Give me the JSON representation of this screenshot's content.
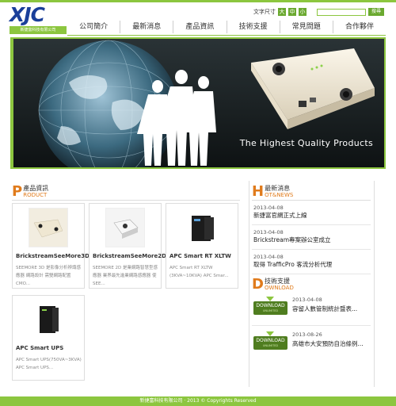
{
  "header": {
    "logo_text": "XJC",
    "logo_tagline": "新捷富科技有限公司",
    "font_size_label": "文字尺寸",
    "font_sizes": [
      "大",
      "中",
      "小"
    ],
    "search_placeholder": "",
    "search_button": "搜尋"
  },
  "nav": {
    "items": [
      "公司簡介",
      "最新消息",
      "產品資訊",
      "技術支援",
      "常見問題",
      "合作夥伴"
    ]
  },
  "banner": {
    "caption": "The Highest Quality Products"
  },
  "products": {
    "big": "P",
    "title_zh": "產品資訊",
    "title_en": "RODUCT",
    "items": [
      {
        "name": "BrickstreamSeeMore3D",
        "desc": "SEEMORE 3D 是影像分析辨識感應器 網路設計 需雙網路配置CMO..."
      },
      {
        "name": "BrickstreamSeeMore2D",
        "desc": "SEEMORE 2D 是業網路智慧型感應器 業界最先進業網路感應器 使SEE..."
      },
      {
        "name": "APC Smart RT XLTW",
        "desc": "APC Smart RT XLTW (3KVA~10KVA) APC Smar..."
      },
      {
        "name": "APC Smart UPS",
        "desc": "APC Smart UPS(750VA~3KVA) APC Smart UPS..."
      }
    ]
  },
  "news": {
    "big": "H",
    "title_zh": "最新消息",
    "title_en": "OT&NEWS",
    "items": [
      {
        "date": "2013-04-08",
        "title": "新捷富官網正式上線"
      },
      {
        "date": "2013-04-08",
        "title": "Brickstream專案辦公室成立"
      },
      {
        "date": "2013-04-08",
        "title": "取得 TrafficPro 客流分析代理"
      }
    ]
  },
  "downloads": {
    "big": "D",
    "title_zh": "技術支援",
    "title_en": "OWNLOAD",
    "button_label": "DOWNLOAD",
    "button_sub": "UNLIMITED",
    "items": [
      {
        "date": "2013-04-08",
        "title": "容留人數管制統計暨表..."
      },
      {
        "date": "2013-08-26",
        "title": "高雄市大安預防自治條例..."
      }
    ]
  },
  "footer": {
    "text": "新捷富科技有限公司 · 2013 © Copyrights Reserved"
  },
  "colors": {
    "accent_green": "#8cc63f",
    "accent_orange": "#e07b1c",
    "logo_blue": "#1a3f9a"
  }
}
